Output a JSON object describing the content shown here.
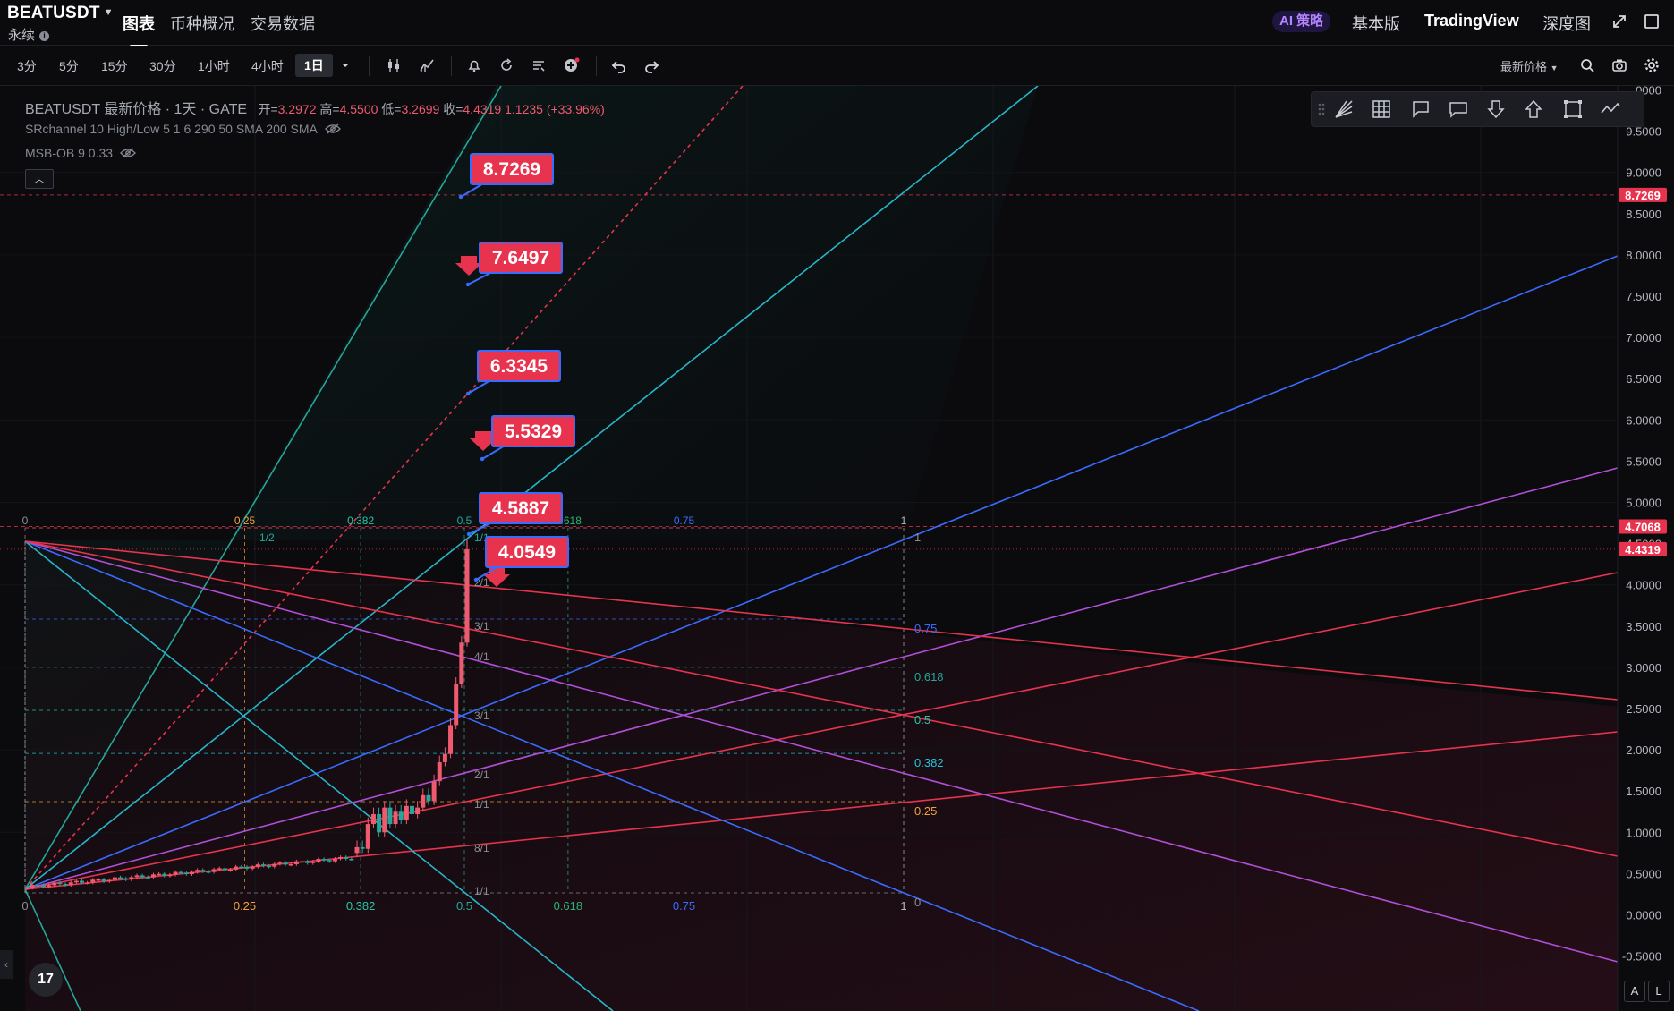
{
  "header": {
    "symbol": "BEATUSDT",
    "sub": "永续",
    "tabs": [
      "图表",
      "币种概况",
      "交易数据"
    ],
    "active_tab": 0,
    "ai_label": "AI 策略",
    "right_links": [
      "基本版",
      "TradingView",
      "深度图"
    ]
  },
  "toolbar": {
    "timeframes": [
      "3分",
      "5分",
      "15分",
      "30分",
      "1小时",
      "4小时",
      "1日"
    ],
    "active_timeframe": "1日",
    "latest_price_label": "最新价格"
  },
  "legend": {
    "title": "BEATUSDT 最新价格 · 1天 · GATE",
    "ohlc": [
      {
        "k": "开=",
        "v": "3.2972"
      },
      {
        "k": "高=",
        "v": "4.5500"
      },
      {
        "k": "低=",
        "v": "3.2699"
      },
      {
        "k": "收=",
        "v": "4.4319"
      }
    ],
    "change": "1.1235 (+33.96%)",
    "indicator1": "SRchannel 10 High/Low 5 1 6 290 50 SMA 200 SMA",
    "indicator2": "MSB-OB 9 0.33"
  },
  "price_axis": {
    "ticks": [
      "0000",
      "9.5000",
      "9.0000",
      "8.5000",
      "8.0000",
      "7.5000",
      "7.0000",
      "6.5000",
      "6.0000",
      "5.5000",
      "5.0000",
      "4.5000",
      "4.0000",
      "3.5000",
      "3.0000",
      "2.5000",
      "2.0000",
      "1.5000",
      "1.0000",
      "0.5000",
      "0.0000",
      "-0.5000"
    ],
    "markers": [
      {
        "label": "8.7269",
        "color": "#e8334e"
      },
      {
        "label": "4.7068",
        "color": "#e8334e"
      },
      {
        "label": "4.4319",
        "color": "#e8334e"
      }
    ]
  },
  "callouts": [
    "8.7269",
    "7.6497",
    "6.3345",
    "5.5329",
    "4.5887",
    "4.0549"
  ],
  "fib_time_top": [
    "0",
    "0.25",
    "0.382",
    "0.5",
    "0.618",
    "0.75",
    "1"
  ],
  "fib_time_bottom": [
    "0",
    "0.25",
    "0.382",
    "0.5",
    "0.618",
    "0.75",
    "1"
  ],
  "fib_price_right": [
    "1",
    "0.75",
    "0.618",
    "0.5",
    "0.382",
    "0.25",
    "0"
  ],
  "gann_labels": [
    "1/2",
    "1/1",
    "2/1",
    "3/1",
    "4/1",
    "3/1",
    "2/1",
    "1/1",
    "8/1",
    "1/1"
  ],
  "colors": {
    "up": "#26a69a",
    "down": "#ef5a6f",
    "accent": "#e8334e",
    "callout_border": "#3a6bff"
  }
}
